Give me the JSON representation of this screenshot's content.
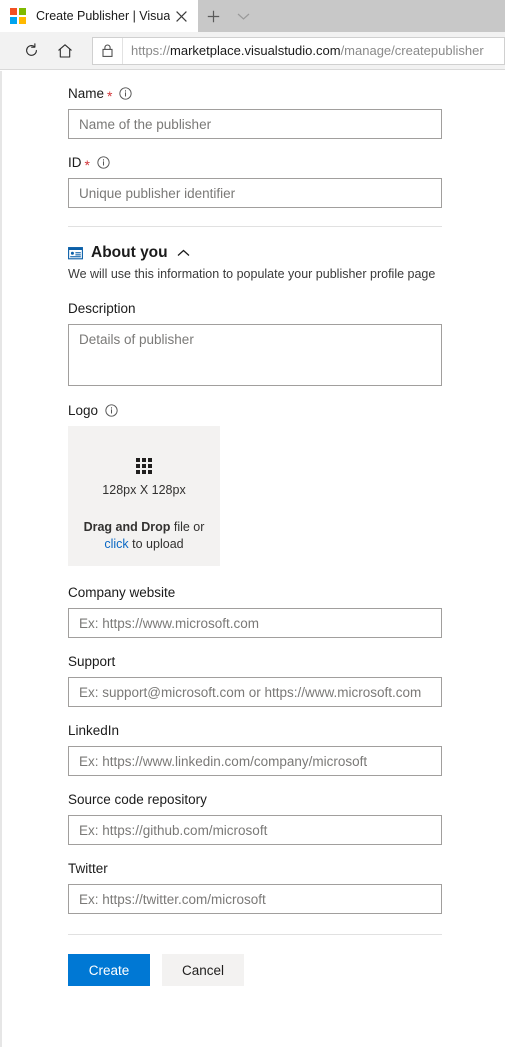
{
  "browser": {
    "tab": {
      "title": "Create Publisher | Visua",
      "favicon": "microsoft-logo-icon",
      "close_icon": "close-icon"
    },
    "new_tab_icon": "plus-icon",
    "tab_list_icon": "chevron-down-icon",
    "toolbar": {
      "refresh_icon": "refresh-icon",
      "home_icon": "home-icon",
      "lock_icon": "lock-icon",
      "url_scheme": "https://",
      "url_host": "marketplace.visualstudio.com",
      "url_path": "/manage/createpublisher"
    }
  },
  "form": {
    "name": {
      "label": "Name",
      "required_mark": "*",
      "info_icon": "info-icon",
      "placeholder": "Name of the publisher",
      "value": ""
    },
    "id": {
      "label": "ID",
      "required_mark": "*",
      "info_icon": "info-icon",
      "placeholder": "Unique publisher identifier",
      "value": ""
    },
    "about_section": {
      "icon": "profile-card-icon",
      "title": "About you",
      "collapse_icon": "chevron-up-icon",
      "subtitle": "We will use this information to populate your publisher profile page"
    },
    "description": {
      "label": "Description",
      "placeholder": "Details of publisher",
      "value": ""
    },
    "logo": {
      "label": "Logo",
      "info_icon": "info-icon",
      "grid_icon": "grid-icon",
      "dimensions": "128px X 128px",
      "drag_bold": "Drag and Drop",
      "drag_rest": " file or",
      "click_link": "click",
      "click_rest": " to upload"
    },
    "company_website": {
      "label": "Company website",
      "placeholder": "Ex: https://www.microsoft.com",
      "value": ""
    },
    "support": {
      "label": "Support",
      "placeholder": "Ex: support@microsoft.com or https://www.microsoft.com",
      "value": ""
    },
    "linkedin": {
      "label": "LinkedIn",
      "placeholder": "Ex: https://www.linkedin.com/company/microsoft",
      "value": ""
    },
    "source_repo": {
      "label": "Source code repository",
      "placeholder": "Ex: https://github.com/microsoft",
      "value": ""
    },
    "twitter": {
      "label": "Twitter",
      "placeholder": "Ex: https://twitter.com/microsoft",
      "value": ""
    },
    "actions": {
      "create_label": "Create",
      "cancel_label": "Cancel"
    }
  },
  "colors": {
    "primary": "#0078d4",
    "required": "#d13438",
    "link": "#0a68c4",
    "dropzone_bg": "#f3f2f1",
    "input_border": "#a19f9d"
  }
}
